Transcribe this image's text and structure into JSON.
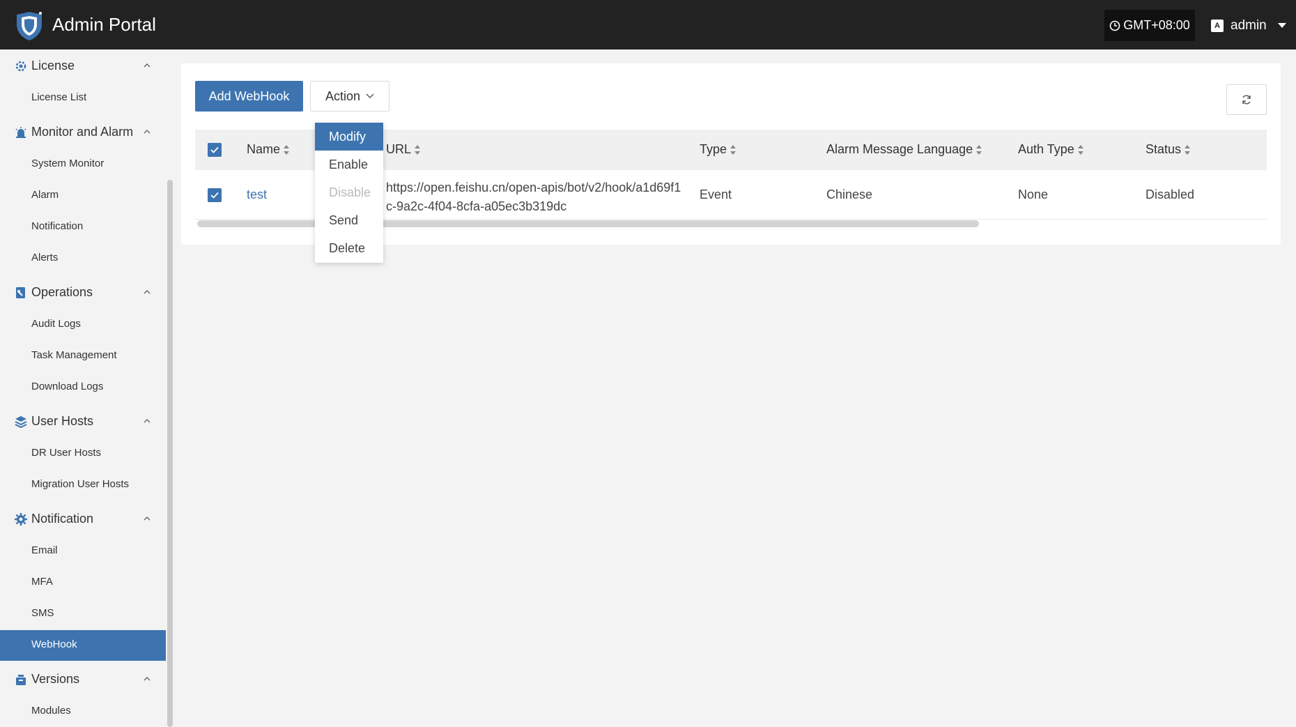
{
  "header": {
    "app_title": "Admin Portal",
    "timezone": "GMT+08:00",
    "username": "admin"
  },
  "sidebar": {
    "groups": [
      {
        "label": "License",
        "icon": "license-icon",
        "items": [
          "License List"
        ]
      },
      {
        "label": "Monitor and Alarm",
        "icon": "alarm-icon",
        "items": [
          "System Monitor",
          "Alarm",
          "Notification",
          "Alerts"
        ]
      },
      {
        "label": "Operations",
        "icon": "operations-icon",
        "items": [
          "Audit Logs",
          "Task Management",
          "Download Logs"
        ]
      },
      {
        "label": "User Hosts",
        "icon": "layers-icon",
        "items": [
          "DR User Hosts",
          "Migration User Hosts"
        ]
      },
      {
        "label": "Notification",
        "icon": "gear-icon",
        "items": [
          "Email",
          "MFA",
          "SMS",
          "WebHook"
        ]
      },
      {
        "label": "Versions",
        "icon": "versions-icon",
        "items": [
          "Modules"
        ]
      }
    ],
    "active_item": "WebHook"
  },
  "toolbar": {
    "add_label": "Add WebHook",
    "action_label": "Action"
  },
  "dropdown": {
    "items": [
      {
        "label": "Modify",
        "state": "highlighted"
      },
      {
        "label": "Enable",
        "state": "normal"
      },
      {
        "label": "Disable",
        "state": "disabled"
      },
      {
        "label": "Send",
        "state": "normal"
      },
      {
        "label": "Delete",
        "state": "normal"
      }
    ]
  },
  "table": {
    "columns": [
      "Name",
      "URL",
      "Type",
      "Alarm Message Language",
      "Auth Type",
      "Status"
    ],
    "rows": [
      {
        "name": "test",
        "url": "https://open.feishu.cn/open-apis/bot/v2/hook/a1d69f1c-9a2c-4f04-8cfa-a05ec3b319dc",
        "type": "Event",
        "language": "Chinese",
        "auth_type": "None",
        "status": "Disabled",
        "checked": true
      }
    ],
    "header_checked": true
  },
  "colors": {
    "accent": "#3d74b0",
    "header_bg": "#222222"
  }
}
